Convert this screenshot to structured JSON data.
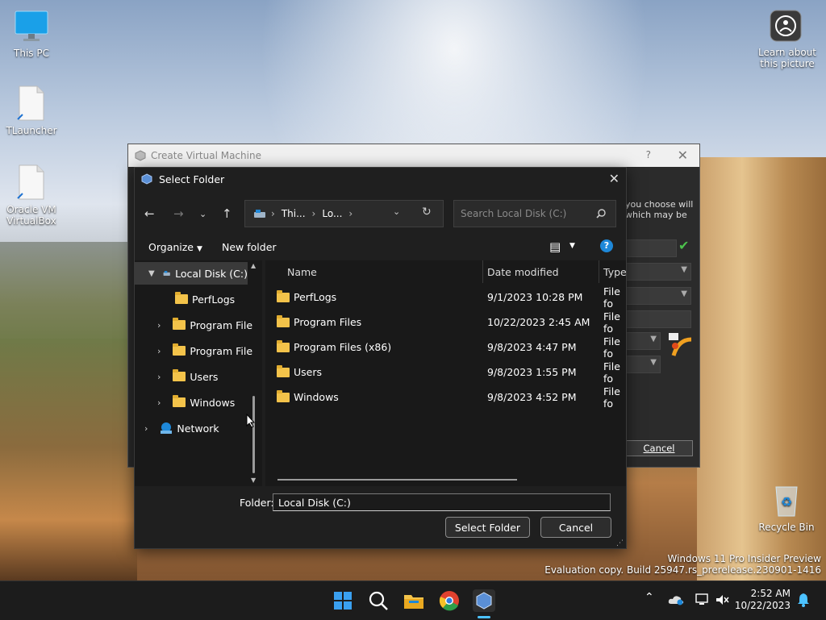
{
  "desktop": {
    "icons": [
      {
        "label": "This PC"
      },
      {
        "label": "TLauncher"
      },
      {
        "label": "Oracle VM VirtualBox"
      },
      {
        "label": "Learn about this picture"
      },
      {
        "label": "Recycle Bin"
      }
    ],
    "watermark_line1": "Windows 11 Pro Insider Preview",
    "watermark_line2": "Evaluation copy. Build 25947.rs_prerelease.230901-1416"
  },
  "background_window": {
    "title": "Create Virtual Machine",
    "help": "?",
    "text_line1": "you choose will",
    "text_line2": "which may be",
    "cancel_label": "Cancel"
  },
  "dialog": {
    "title": "Select Folder",
    "address": {
      "segment1": "Thi...",
      "segment2": "Lo..."
    },
    "search_placeholder": "Search Local Disk (C:)",
    "organize_label": "Organize",
    "new_folder_label": "New folder",
    "tree": [
      {
        "label": "Local Disk (C:)"
      },
      {
        "label": "PerfLogs"
      },
      {
        "label": "Program File"
      },
      {
        "label": "Program File"
      },
      {
        "label": "Users"
      },
      {
        "label": "Windows"
      },
      {
        "label": "Network"
      }
    ],
    "columns": {
      "name": "Name",
      "date": "Date modified",
      "type": "Type"
    },
    "files": [
      {
        "name": "PerfLogs",
        "date": "9/1/2023 10:28 PM",
        "type": "File fo"
      },
      {
        "name": "Program Files",
        "date": "10/22/2023 2:45 AM",
        "type": "File fo"
      },
      {
        "name": "Program Files (x86)",
        "date": "9/8/2023 4:47 PM",
        "type": "File fo"
      },
      {
        "name": "Users",
        "date": "9/8/2023 1:55 PM",
        "type": "File fo"
      },
      {
        "name": "Windows",
        "date": "9/8/2023 4:52 PM",
        "type": "File fo"
      }
    ],
    "folder_label": "Folder:",
    "folder_value": "Local Disk (C:)",
    "select_label": "Select Folder",
    "cancel_label": "Cancel"
  },
  "taskbar": {
    "time": "2:52 AM",
    "date": "10/22/2023"
  },
  "colors": {
    "accent": "#0078d4",
    "dialog_bg": "#1f1f1f",
    "folder": "#f3c34a"
  }
}
